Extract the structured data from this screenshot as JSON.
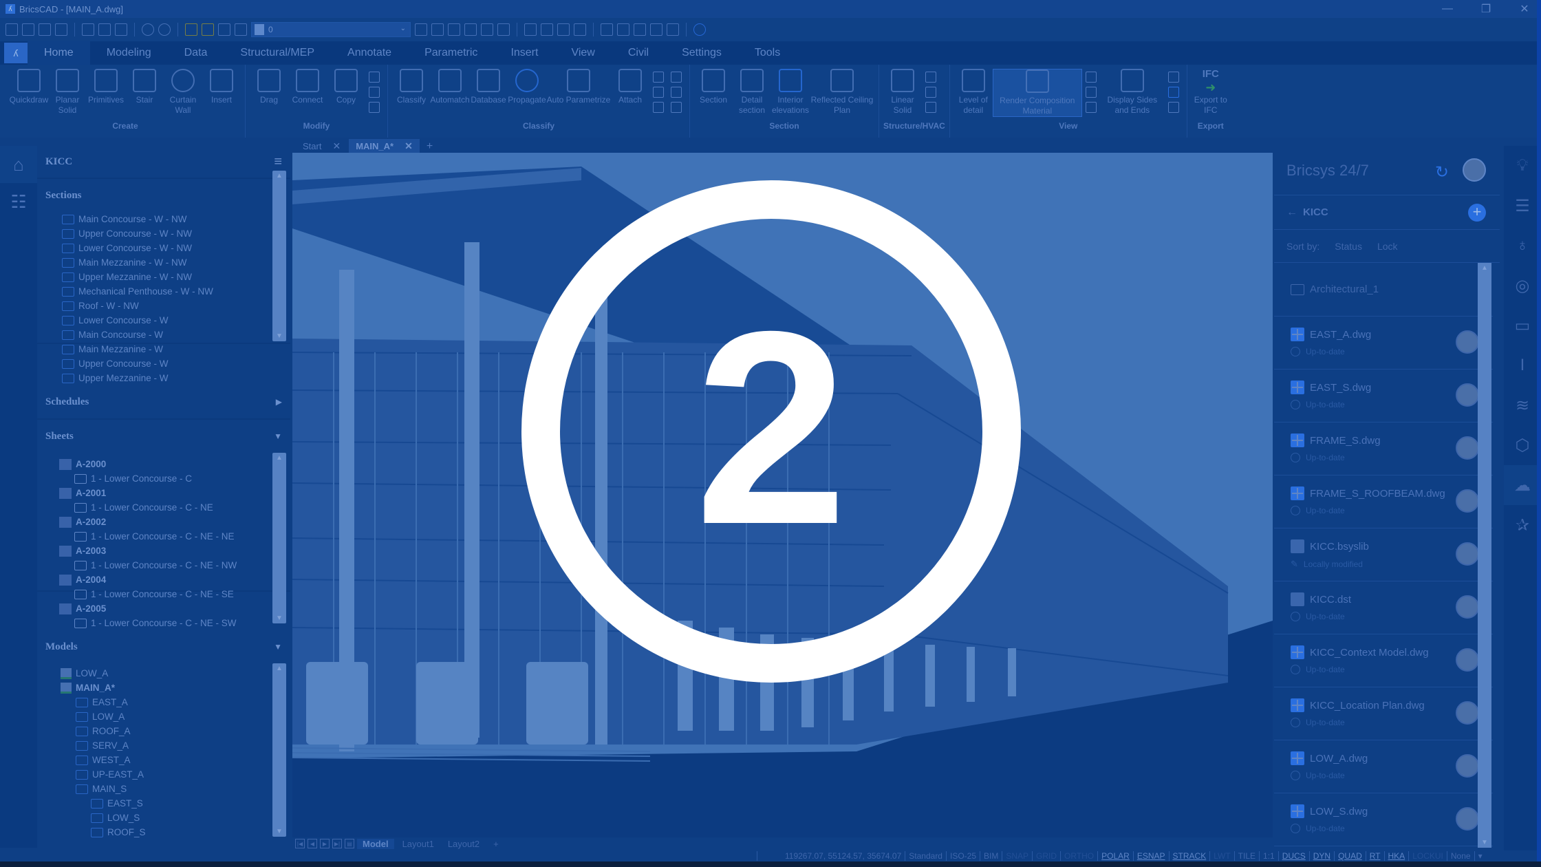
{
  "window": {
    "title": "BricsCAD - [MAIN_A.dwg]",
    "controls": {
      "minimize": "—",
      "restore": "❐",
      "close": "✕"
    }
  },
  "quick_access": {
    "layer_value": "0",
    "icons": [
      "new-icon",
      "open-icon",
      "save-icon",
      "save-as-icon",
      "plot-icon",
      "plot-preview-icon",
      "publish-icon",
      "undo-icon",
      "redo-icon",
      "layer-on-icon",
      "layer-freeze-icon",
      "layer-lock-icon",
      "layer-print-icon",
      "layer-color-icon"
    ]
  },
  "ribbon_tabs": [
    "Home",
    "Modeling",
    "Data",
    "Structural/MEP",
    "Annotate",
    "Parametric",
    "Insert",
    "View",
    "Civil",
    "Settings",
    "Tools"
  ],
  "ribbon_active_tab": "Home",
  "ribbon_groups": [
    {
      "label": "Create",
      "buttons": [
        "Quickdraw",
        "Planar Solid",
        "Primitives",
        "Stair",
        "Curtain Wall",
        "Insert"
      ]
    },
    {
      "label": "Modify",
      "buttons": [
        "Drag",
        "Connect",
        "Copy"
      ]
    },
    {
      "label": "Classify",
      "buttons": [
        "Classify",
        "Automatch",
        "Database",
        "Propagate",
        "Auto Parametrize",
        "Attach"
      ]
    },
    {
      "label": "Section",
      "buttons": [
        "Section",
        "Detail section",
        "Interior elevations",
        "Reflected Ceiling Plan"
      ]
    },
    {
      "label": "Structure/HVAC",
      "buttons": [
        "Linear Solid"
      ]
    },
    {
      "label": "View",
      "buttons": [
        "Level of detail",
        "Render Composition Material",
        "Display Sides and Ends"
      ]
    },
    {
      "label": "Export",
      "buttons": [
        "Export to IFC"
      ],
      "badge": "IFC"
    }
  ],
  "doc_tabs": [
    {
      "label": "Start",
      "close": "✕"
    },
    {
      "label": "MAIN_A*",
      "close": "✕",
      "active": true
    }
  ],
  "doc_tab_add": "+",
  "left_panel": {
    "title": "KICC",
    "sections": {
      "label": "Sections",
      "items": [
        "Main Concourse - W - NW",
        "Upper Concourse - W - NW",
        "Lower Concourse - W - NW",
        "Main Mezzanine - W - NW",
        "Upper Mezzanine - W - NW",
        "Mechanical Penthouse - W - NW",
        "Roof - W - NW",
        "Lower Concourse - W",
        "Main Concourse - W",
        "Main Mezzanine - W",
        "Upper Concourse - W",
        "Upper Mezzanine - W"
      ]
    },
    "schedules": {
      "label": "Schedules"
    },
    "sheets": {
      "label": "Sheets",
      "items": [
        {
          "sheet": "A-2000",
          "view": "1 - Lower Concourse - C"
        },
        {
          "sheet": "A-2001",
          "view": "1 - Lower Concourse - C - NE"
        },
        {
          "sheet": "A-2002",
          "view": "1 - Lower Concourse - C - NE - NE"
        },
        {
          "sheet": "A-2003",
          "view": "1 - Lower Concourse - C - NE - NW"
        },
        {
          "sheet": "A-2004",
          "view": "1 - Lower Concourse - C - NE - SE"
        },
        {
          "sheet": "A-2005",
          "view": "1 - Lower Concourse - C - NE - SW"
        }
      ]
    },
    "models": {
      "label": "Models",
      "items": [
        {
          "name": "LOW_A",
          "level": 0
        },
        {
          "name": "MAIN_A*",
          "level": 0,
          "bold": true
        },
        {
          "name": "EAST_A",
          "level": 1
        },
        {
          "name": "LOW_A",
          "level": 1
        },
        {
          "name": "ROOF_A",
          "level": 1
        },
        {
          "name": "SERV_A",
          "level": 1
        },
        {
          "name": "WEST_A",
          "level": 1
        },
        {
          "name": "UP-EAST_A",
          "level": 1
        },
        {
          "name": "MAIN_S",
          "level": 1
        },
        {
          "name": "EAST_S",
          "level": 2
        },
        {
          "name": "LOW_S",
          "level": 2
        },
        {
          "name": "ROOF_S",
          "level": 2
        }
      ]
    }
  },
  "layout_tabs": [
    "Model",
    "Layout1",
    "Layout2",
    "+"
  ],
  "layout_active": "Model",
  "status_bar": {
    "coords": "119267.07, 55124.57, 35674.07",
    "cells": [
      {
        "label": "Standard",
        "state": "plain"
      },
      {
        "label": "ISO-25",
        "state": "plain"
      },
      {
        "label": "BIM",
        "state": "plain"
      },
      {
        "label": "SNAP",
        "state": "off"
      },
      {
        "label": "GRID",
        "state": "off"
      },
      {
        "label": "ORTHO",
        "state": "off"
      },
      {
        "label": "POLAR",
        "state": "on"
      },
      {
        "label": "ESNAP",
        "state": "on"
      },
      {
        "label": "STRACK",
        "state": "on"
      },
      {
        "label": "LWT",
        "state": "off"
      },
      {
        "label": "TILE",
        "state": "plain"
      },
      {
        "label": "1:1",
        "state": "plain"
      },
      {
        "label": "DUCS",
        "state": "on"
      },
      {
        "label": "DYN",
        "state": "on"
      },
      {
        "label": "QUAD",
        "state": "on"
      },
      {
        "label": "RT",
        "state": "on"
      },
      {
        "label": "HKA",
        "state": "on"
      },
      {
        "label": "LOCKUI",
        "state": "off"
      },
      {
        "label": "None",
        "state": "plain"
      }
    ]
  },
  "right_panel": {
    "title": "Bricsys 24/7",
    "breadcrumb": "KICC",
    "sort_label": "Sort by:",
    "sort_options": [
      "Status",
      "Lock"
    ],
    "folder": "Architectural_1",
    "files": [
      {
        "name": "EAST_A.dwg",
        "status": "Up-to-date",
        "type": "dwg"
      },
      {
        "name": "EAST_S.dwg",
        "status": "Up-to-date",
        "type": "dwg"
      },
      {
        "name": "FRAME_S.dwg",
        "status": "Up-to-date",
        "type": "dwg"
      },
      {
        "name": "FRAME_S_ROOFBEAM.dwg",
        "status": "Up-to-date",
        "type": "dwg"
      },
      {
        "name": "KICC.bsyslib",
        "status": "Locally modified",
        "type": "doc"
      },
      {
        "name": "KICC.dst",
        "status": "Up-to-date",
        "type": "doc"
      },
      {
        "name": "KICC_Context Model.dwg",
        "status": "Up-to-date",
        "type": "dwg"
      },
      {
        "name": "KICC_Location Plan.dwg",
        "status": "Up-to-date",
        "type": "dwg"
      },
      {
        "name": "LOW_A.dwg",
        "status": "Up-to-date",
        "type": "dwg"
      },
      {
        "name": "LOW_S.dwg",
        "status": "Up-to-date",
        "type": "dwg"
      }
    ]
  },
  "right_rail_icons": [
    "lightbulb-icon",
    "sliders-icon",
    "balloon-icon",
    "propagate-icon",
    "ruler-icon",
    "beam-icon",
    "layers-icon",
    "component-icon",
    "cloud-upload-icon",
    "pin-icon"
  ],
  "left_rail_icons": [
    "home-icon",
    "structure-tree-icon"
  ],
  "overlay": {
    "number": "2",
    "color": "#ffffff"
  },
  "colors": {
    "overlay_tint": "#0e3f85",
    "accent": "#2a6fe0"
  }
}
